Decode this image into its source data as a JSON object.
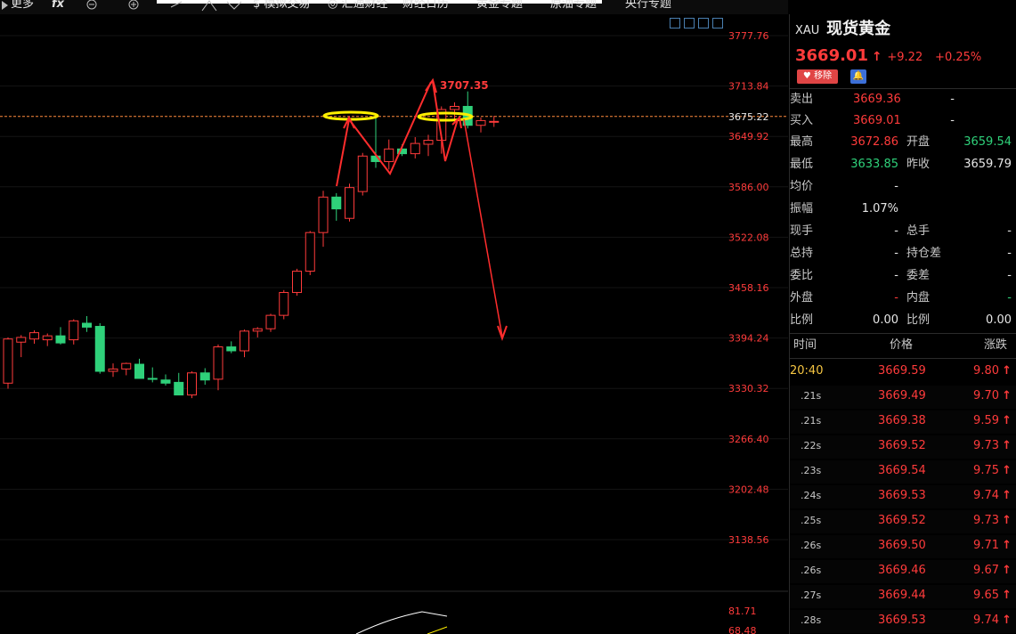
{
  "toolbar": {
    "more": "更多",
    "fx": "fx",
    "sim_trade": "模拟交易",
    "fx_finance": "汇通财经",
    "calendar": "财经日历",
    "gold_topic": "黄金专题",
    "oil_topic": "原油专题",
    "cb_topic": "央行专题"
  },
  "chart_data": {
    "type": "candlestick",
    "y_ticks": [
      "3777.76",
      "3713.84",
      "3649.92",
      "3586.00",
      "3522.08",
      "3458.16",
      "3394.24",
      "3330.32",
      "3266.40",
      "3202.48",
      "3138.56"
    ],
    "current_price_label": "3675.22",
    "annotation_high": "3707.35",
    "indicator_ticks": [
      "81.71",
      "68.48"
    ],
    "colors": {
      "up": "#ff3b3b",
      "down": "#2fd17a",
      "arrow": "#ff2d2d",
      "highlight": "#ffef00"
    },
    "candles": [
      {
        "o": 3337,
        "h": 3395,
        "l": 3330,
        "c": 3393
      },
      {
        "o": 3389,
        "h": 3398,
        "l": 3370,
        "c": 3395
      },
      {
        "o": 3393,
        "h": 3404,
        "l": 3387,
        "c": 3401
      },
      {
        "o": 3392,
        "h": 3400,
        "l": 3384,
        "c": 3397
      },
      {
        "o": 3397,
        "h": 3408,
        "l": 3386,
        "c": 3388
      },
      {
        "o": 3392,
        "h": 3418,
        "l": 3386,
        "c": 3416
      },
      {
        "o": 3413,
        "h": 3422,
        "l": 3402,
        "c": 3408
      },
      {
        "o": 3409,
        "h": 3413,
        "l": 3349,
        "c": 3352
      },
      {
        "o": 3352,
        "h": 3362,
        "l": 3345,
        "c": 3355
      },
      {
        "o": 3355,
        "h": 3363,
        "l": 3347,
        "c": 3362
      },
      {
        "o": 3361,
        "h": 3368,
        "l": 3343,
        "c": 3343
      },
      {
        "o": 3343,
        "h": 3357,
        "l": 3338,
        "c": 3342
      },
      {
        "o": 3341,
        "h": 3348,
        "l": 3334,
        "c": 3337
      },
      {
        "o": 3338,
        "h": 3350,
        "l": 3322,
        "c": 3322
      },
      {
        "o": 3322,
        "h": 3352,
        "l": 3318,
        "c": 3350
      },
      {
        "o": 3350,
        "h": 3356,
        "l": 3335,
        "c": 3341
      },
      {
        "o": 3342,
        "h": 3386,
        "l": 3328,
        "c": 3383
      },
      {
        "o": 3383,
        "h": 3390,
        "l": 3375,
        "c": 3378
      },
      {
        "o": 3378,
        "h": 3405,
        "l": 3370,
        "c": 3403
      },
      {
        "o": 3403,
        "h": 3408,
        "l": 3395,
        "c": 3406
      },
      {
        "o": 3406,
        "h": 3425,
        "l": 3402,
        "c": 3423
      },
      {
        "o": 3423,
        "h": 3455,
        "l": 3418,
        "c": 3452
      },
      {
        "o": 3452,
        "h": 3482,
        "l": 3448,
        "c": 3479
      },
      {
        "o": 3479,
        "h": 3530,
        "l": 3474,
        "c": 3528
      },
      {
        "o": 3528,
        "h": 3581,
        "l": 3510,
        "c": 3573
      },
      {
        "o": 3573,
        "h": 3578,
        "l": 3543,
        "c": 3558
      },
      {
        "o": 3546,
        "h": 3590,
        "l": 3542,
        "c": 3585
      },
      {
        "o": 3580,
        "h": 3629,
        "l": 3575,
        "c": 3625
      },
      {
        "o": 3625,
        "h": 3677,
        "l": 3610,
        "c": 3618
      },
      {
        "o": 3618,
        "h": 3646,
        "l": 3608,
        "c": 3634
      },
      {
        "o": 3634,
        "h": 3640,
        "l": 3625,
        "c": 3628
      },
      {
        "o": 3628,
        "h": 3649,
        "l": 3622,
        "c": 3641
      },
      {
        "o": 3640,
        "h": 3652,
        "l": 3625,
        "c": 3645
      },
      {
        "o": 3645,
        "h": 3688,
        "l": 3628,
        "c": 3684
      },
      {
        "o": 3684,
        "h": 3693,
        "l": 3668,
        "c": 3688
      },
      {
        "o": 3688,
        "h": 3707,
        "l": 3660,
        "c": 3664
      },
      {
        "o": 3664,
        "h": 3674,
        "l": 3655,
        "c": 3670
      },
      {
        "o": 3668,
        "h": 3676,
        "l": 3662,
        "c": 3669
      }
    ]
  },
  "quote": {
    "symbol": "XAU",
    "name": "现货黄金",
    "price": "3669.01",
    "arrow": "↑",
    "change": "+9.22",
    "change_pct": "+0.25%",
    "remove_label": "移除",
    "rows": [
      {
        "l1": "卖出",
        "v1": "3669.36",
        "c1": "red",
        "l2": "",
        "v2": "-",
        "c2": "white"
      },
      {
        "l1": "买入",
        "v1": "3669.01",
        "c1": "red",
        "l2": "",
        "v2": "-",
        "c2": "white"
      },
      {
        "l1": "最高",
        "v1": "3672.86",
        "c1": "red",
        "l2": "开盘",
        "v2": "3659.54",
        "c2": "green"
      },
      {
        "l1": "最低",
        "v1": "3633.85",
        "c1": "green",
        "l2": "昨收",
        "v2": "3659.79",
        "c2": "white"
      },
      {
        "l1": "均价",
        "v1": "-",
        "c1": "white",
        "l2": "",
        "v2": "",
        "c2": "white"
      },
      {
        "l1": "振幅",
        "v1": "1.07%",
        "c1": "white",
        "l2": "",
        "v2": "",
        "c2": "white"
      },
      {
        "l1": "现手",
        "v1": "-",
        "c1": "white",
        "l2": "总手",
        "v2": "-",
        "c2": "white"
      },
      {
        "l1": "总持",
        "v1": "-",
        "c1": "white",
        "l2": "持仓差",
        "v2": "-",
        "c2": "white"
      },
      {
        "l1": "委比",
        "v1": "-",
        "c1": "white",
        "l2": "委差",
        "v2": "-",
        "c2": "white"
      },
      {
        "l1": "外盘",
        "v1": "-",
        "c1": "red",
        "l2": "内盘",
        "v2": "-",
        "c2": "green"
      },
      {
        "l1": "比例",
        "v1": "0.00",
        "c1": "white",
        "l2": "比例",
        "v2": "0.00",
        "c2": "white"
      }
    ]
  },
  "ticks": {
    "headers": [
      "时间",
      "价格",
      "涨跌"
    ],
    "rows": [
      {
        "t": "20:40",
        "p": "3669.59",
        "c": "9.80"
      },
      {
        "t": ".21s",
        "p": "3669.49",
        "c": "9.70"
      },
      {
        "t": ".21s",
        "p": "3669.38",
        "c": "9.59"
      },
      {
        "t": ".22s",
        "p": "3669.52",
        "c": "9.73"
      },
      {
        "t": ".23s",
        "p": "3669.54",
        "c": "9.75"
      },
      {
        "t": ".24s",
        "p": "3669.53",
        "c": "9.74"
      },
      {
        "t": ".25s",
        "p": "3669.52",
        "c": "9.73"
      },
      {
        "t": ".26s",
        "p": "3669.50",
        "c": "9.71"
      },
      {
        "t": ".26s",
        "p": "3669.46",
        "c": "9.67"
      },
      {
        "t": ".27s",
        "p": "3669.44",
        "c": "9.65"
      },
      {
        "t": ".28s",
        "p": "3669.53",
        "c": "9.74"
      }
    ]
  }
}
